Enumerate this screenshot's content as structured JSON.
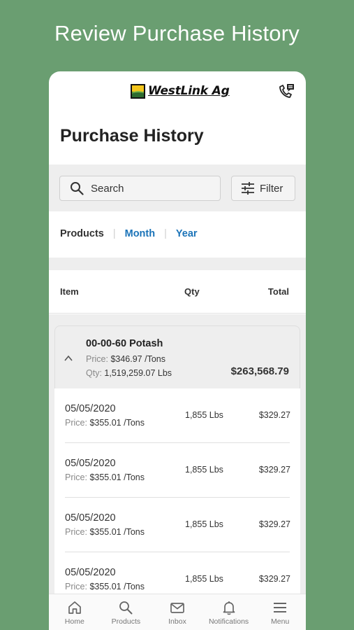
{
  "promo": {
    "title": "Review Purchase History"
  },
  "header": {
    "brand": "WestLink Ag",
    "title": "Purchase History"
  },
  "search": {
    "label": "Search"
  },
  "filter": {
    "label": "Filter"
  },
  "tabs": {
    "products": "Products",
    "month": "Month",
    "year": "Year"
  },
  "table": {
    "headers": {
      "item": "Item",
      "qty": "Qty",
      "total": "Total"
    },
    "product": {
      "name": "00-00-60 Potash",
      "price_label": "Price:",
      "price": "$346.97 /Tons",
      "qty_label": "Qty:",
      "qty": "1,519,259.07 Lbs",
      "total": "$263,568.79"
    },
    "rows": [
      {
        "date": "05/05/2020",
        "price_label": "Price:",
        "price": "$355.01 /Tons",
        "qty": "1,855 Lbs",
        "total": "$329.27"
      },
      {
        "date": "05/05/2020",
        "price_label": "Price:",
        "price": "$355.01 /Tons",
        "qty": "1,855 Lbs",
        "total": "$329.27"
      },
      {
        "date": "05/05/2020",
        "price_label": "Price:",
        "price": "$355.01 /Tons",
        "qty": "1,855 Lbs",
        "total": "$329.27"
      },
      {
        "date": "05/05/2020",
        "price_label": "Price:",
        "price": "$355.01 /Tons",
        "qty": "1,855 Lbs",
        "total": "$329.27"
      }
    ]
  },
  "nav": {
    "home": "Home",
    "products": "Products",
    "inbox": "Inbox",
    "notifications": "Notifications",
    "menu": "Menu"
  },
  "colors": {
    "background": "#6a9e71",
    "link": "#1a73b8",
    "band": "#eeeeee"
  },
  "icons": [
    "phone-icon",
    "search-icon",
    "filter-icon",
    "chevron-up-icon",
    "home-icon",
    "products-search-icon",
    "inbox-icon",
    "bell-icon",
    "menu-icon"
  ]
}
